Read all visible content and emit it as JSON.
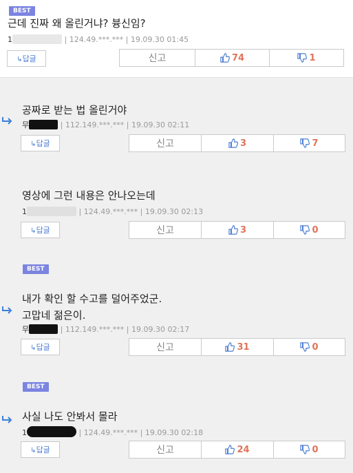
{
  "comments": [
    {
      "best": "BEST",
      "text": [
        "근데 진짜 왜 올린거냐? 븅신임?"
      ],
      "author": "1",
      "meta": "| 124.49.***.*** | 19.09.30 01:45",
      "reply_label": "답글",
      "report_label": "신고",
      "up": "74",
      "down": "1"
    },
    {
      "text": [
        "공짜로 받는 법 올린거야"
      ],
      "author": "무",
      "meta": "| 112.149.***.*** | 19.09.30 02:11",
      "reply_label": "답글",
      "report_label": "신고",
      "up": "3",
      "down": "7"
    },
    {
      "text": [
        "영상에 그런 내용은 안나오는데"
      ],
      "author": "1",
      "meta": "| 124.49.***.*** | 19.09.30 02:13",
      "reply_label": "답글",
      "report_label": "신고",
      "up": "3",
      "down": "0"
    },
    {
      "best": "BEST",
      "text": [
        "내가 확인 할 수고를 덜어주었군.",
        "고맙네 젊은이."
      ],
      "author": "무",
      "meta": "| 112.149.***.*** | 19.09.30 02:17",
      "reply_label": "답글",
      "report_label": "신고",
      "up": "31",
      "down": "0"
    },
    {
      "best": "BEST",
      "text": [
        "사실 나도 안봐서 몰라"
      ],
      "author": "1",
      "meta": "| 124.49.***.*** | 19.09.30 02:18",
      "reply_label": "답글",
      "report_label": "신고",
      "up": "24",
      "down": "0"
    }
  ],
  "colors": {
    "best_badge": "#7b84e0",
    "reply_arrow": "#3a7fd8",
    "vote_count": "#e0745a",
    "vote_icon": "#4a7bd1"
  },
  "icons": {
    "reply_arrow": "reply-arrow-icon",
    "thumbs_up": "thumbs-up-icon",
    "thumbs_down": "thumbs-down-icon"
  }
}
